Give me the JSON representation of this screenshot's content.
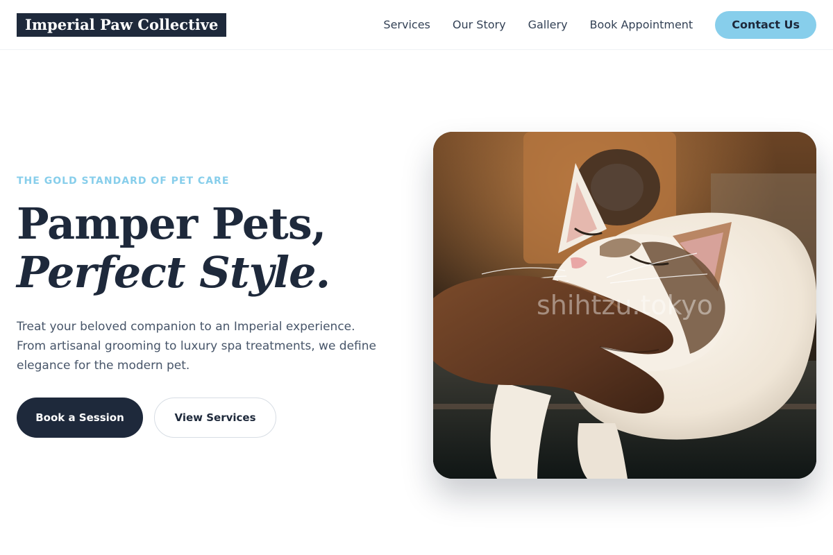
{
  "brand": {
    "name": "Imperial Paw Collective"
  },
  "nav": {
    "items": [
      {
        "label": "Services"
      },
      {
        "label": "Our Story"
      },
      {
        "label": "Gallery"
      },
      {
        "label": "Book Appointment"
      }
    ],
    "cta_label": "Contact Us"
  },
  "hero": {
    "eyebrow": "THE GOLD STANDARD OF PET CARE",
    "headline_line1": "Pamper Pets,",
    "headline_line2": "Perfect Style.",
    "description": "Treat your beloved companion to an Imperial experience. From artisanal grooming to luxury spa treatments, we define elegance for the modern pet.",
    "primary_button": "Book a Session",
    "secondary_button": "View Services",
    "image": {
      "subject": "cat-being-scratched-under-chin",
      "watermark": "shihtzu.tokyo"
    }
  },
  "colors": {
    "navy": "#1e293b",
    "sky_accent": "#87ceeb",
    "body_text": "#475569",
    "background": "#ffffff"
  }
}
